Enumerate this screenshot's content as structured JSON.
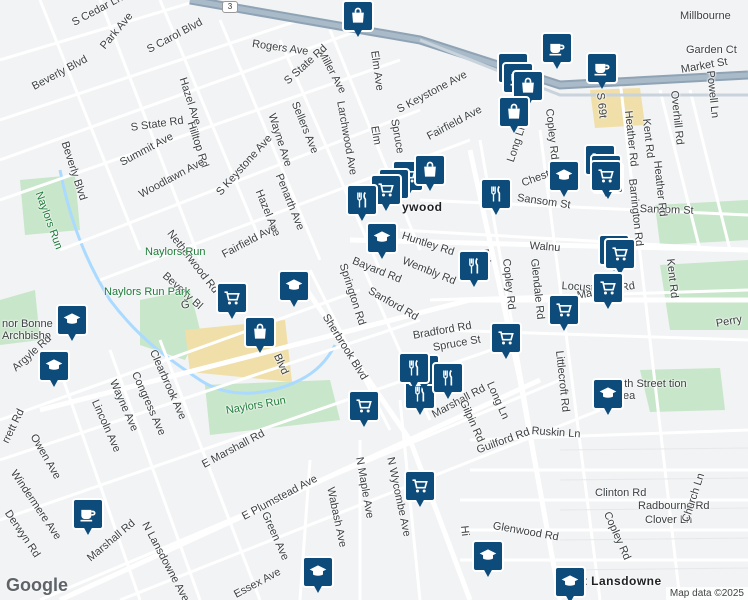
{
  "map": {
    "colors": {
      "land": "#f1f3f4",
      "road": "#ffffff",
      "highway": "#8fa3b5",
      "park": "#c8e6c9",
      "water": "#aadaff",
      "pin": "#0d4b7a",
      "zone": "#f0dfa8"
    },
    "place_labels": {
      "neighborhood": "ywood",
      "eastLansdowne": "East Lansdowne",
      "manorBonner": "nor Bonne Archbisho",
      "naylorsRunPark": "Naylors Run Park",
      "naylorsRun1": "Naylors Run",
      "naylorsRun2": "Naylors Run",
      "naylorsRun3": "Naylors Run",
      "sixtyNinth": "69th Street tion Area",
      "route3": "3"
    },
    "street_labels": {
      "sCedarLn": "S Cedar Ln",
      "parkAve": "Park Ave",
      "sCarolBlvd": "S Carol Blvd",
      "rogersAve": "Rogers Ave",
      "millerAve": "Miller Ave",
      "elmAve": "Elm Ave",
      "sStateRd1": "S State Rd",
      "sStateRd2": "S State Rd",
      "hazelAve1": "Hazel Ave",
      "hazelAve2": "Hazel Ave",
      "beverlyBlvd1": "Beverly Blvd",
      "beverlyBlvd2": "Beverly Blvd",
      "beverlyBlvd3": "Beverly Bl",
      "sellersAve": "Sellers Ave",
      "larchwoodAve": "Larchwood Ave",
      "sKeystoneAve1": "S Keystone Ave",
      "sKeystoneAve2": "S Keystone Ave",
      "waynaAve": "Wayne Ave",
      "hilltopRd": "Hilltop Rd",
      "summitAve": "Summit Ave",
      "woodlawnAve": "Woodlawn Ave",
      "penarthAve": "Penarth Ave",
      "fairfieldAve1": "Fairfield Ave",
      "fairfieldAve2": "Fairfield Ave",
      "spruce1": "Spruce",
      "elm2": "Elm",
      "netherwoodRd": "Netherwood Rd",
      "bayardRd": "Bayard Rd",
      "wemblyRd": "Wembly Rd",
      "sanfordRd": "Sanford Rd",
      "springtonRd": "Springton Rd",
      "huntleyRd": "Huntley Rd",
      "sherbrookBlvd": "Sherbrook Blvd",
      "bradfordRd": "Bradford Rd",
      "spruceSt": "Spruce St",
      "marshallRd1": "Marshall Rd",
      "marshallRd2": "Marshall Rd",
      "marshallRd3": "E Marshall Rd",
      "marshallRd4": "Marshall Rd",
      "longLn1": "Long Ln",
      "longLn2": "Long Ln",
      "gilpinRd": "Gilpin Rd",
      "copleyRd1": "Copley Rd",
      "copleyRd2": "Copley Rd",
      "copleyRd3": "Copley Rd",
      "glendaleRd": "Glendale Rd",
      "sansomSt1": "Sansom St",
      "sansomSt2": "Sansom St",
      "walnut": "Walnu",
      "locust": "Locust",
      "barringtonRd": "Barrington Rd",
      "heatherRd1": "Heather Rd",
      "heatherRd2": "Heather Rd",
      "kentRd1": "Kent Rd",
      "kentRd2": "Kent Rd",
      "overhillRd": "Overhill Rd",
      "powellLn": "Powell Ln",
      "gardenCt": "Garden Ct",
      "marketSt": "Market St",
      "millbourne": "Millbourne",
      "perry": "Perry",
      "littlecroftRd": "Littlecroft Rd",
      "ruskinLn": "Ruskin Ln",
      "guilfordRd": "Guilford Rd",
      "clintonRd": "Clinton Rd",
      "radbourneRd": "Radbourne Rd",
      "cloverLn": "Clover Ln",
      "glenwoodRd": "Glenwood Rd",
      "churchLn": "Church Ln",
      "argyleRd": "Argyle Rd",
      "owenAve": "Owen Ave",
      "rrettRd": "rrett Rd",
      "windermereAve": "Windermere Ave",
      "derwynRd": "Derwyn Rd",
      "lincolnAve": "Lincoln Ave",
      "waynaAve2": "Wayne Ave",
      "congressAve": "Congress Ave",
      "clearbrookAve": "Clearbrook Ave",
      "ePlumsteadAve": "E Plumstead Ave",
      "nLansdowneAve": "N Lansdowne Ave",
      "greenAve": "Green Ave",
      "essexAve": "Essex Ave",
      "wabashAve": "Wabash Ave",
      "nMapleAve": "N Maple Ave",
      "nWycombeAve": "N Wycombe Ave",
      "chest": "Chest",
      "blvd": "Blvd",
      "gl": "G",
      "hi": "Hi",
      "s69": "S 69t",
      "rd1": "Rd",
      "rd2": "Rd",
      "rd3": "Rd"
    },
    "pins": [
      {
        "icon": "shopping-bag-icon",
        "name": "pin-shopping-bag"
      },
      {
        "icon": "coffee-cup-icon",
        "name": "pin-coffee"
      },
      {
        "icon": "coffee-cup-icon",
        "name": "pin-coffee"
      },
      {
        "icon": "coffee-cup-icon",
        "name": "pin-coffee"
      },
      {
        "icon": "coffee-cup-icon",
        "name": "pin-coffee"
      },
      {
        "icon": "shopping-bag-icon",
        "name": "pin-shopping-bag"
      },
      {
        "icon": "shopping-bag-icon",
        "name": "pin-shopping-bag"
      },
      {
        "icon": "shopping-cart-icon",
        "name": "pin-grocery"
      },
      {
        "icon": "shopping-cart-icon",
        "name": "pin-grocery"
      },
      {
        "icon": "shopping-cart-icon",
        "name": "pin-grocery"
      },
      {
        "icon": "shopping-bag-icon",
        "name": "pin-shopping-bag"
      },
      {
        "icon": "fork-knife-icon",
        "name": "pin-restaurant"
      },
      {
        "icon": "fork-knife-icon",
        "name": "pin-restaurant"
      },
      {
        "icon": "graduation-cap-icon",
        "name": "pin-school"
      },
      {
        "icon": "graduation-cap-icon",
        "name": "pin-school"
      },
      {
        "icon": "shopping-cart-icon",
        "name": "pin-grocery"
      },
      {
        "icon": "shopping-cart-icon",
        "name": "pin-grocery"
      },
      {
        "icon": "shopping-cart-icon",
        "name": "pin-grocery"
      },
      {
        "icon": "shopping-bag-icon",
        "name": "pin-shopping-bag"
      },
      {
        "icon": "shopping-cart-icon",
        "name": "pin-grocery"
      },
      {
        "icon": "fork-knife-icon",
        "name": "pin-restaurant"
      },
      {
        "icon": "shopping-cart-icon",
        "name": "pin-grocery"
      },
      {
        "icon": "shopping-cart-icon",
        "name": "pin-grocery"
      },
      {
        "icon": "graduation-cap-icon",
        "name": "pin-school"
      },
      {
        "icon": "shopping-cart-icon",
        "name": "pin-grocery"
      },
      {
        "icon": "shopping-bag-icon",
        "name": "pin-shopping-bag"
      },
      {
        "icon": "graduation-cap-icon",
        "name": "pin-school"
      },
      {
        "icon": "graduation-cap-icon",
        "name": "pin-school"
      },
      {
        "icon": "shopping-cart-icon",
        "name": "pin-grocery"
      },
      {
        "icon": "shopping-cart-icon",
        "name": "pin-grocery"
      },
      {
        "icon": "shopping-cart-icon",
        "name": "pin-grocery"
      },
      {
        "icon": "fork-knife-icon",
        "name": "pin-restaurant"
      },
      {
        "icon": "fork-knife-icon",
        "name": "pin-restaurant"
      },
      {
        "icon": "fork-knife-icon",
        "name": "pin-restaurant"
      },
      {
        "icon": "fork-knife-icon",
        "name": "pin-restaurant"
      },
      {
        "icon": "graduation-cap-icon",
        "name": "pin-school"
      },
      {
        "icon": "shopping-cart-icon",
        "name": "pin-grocery"
      },
      {
        "icon": "coffee-cup-icon",
        "name": "pin-coffee"
      },
      {
        "icon": "graduation-cap-icon",
        "name": "pin-school"
      },
      {
        "icon": "graduation-cap-icon",
        "name": "pin-school"
      },
      {
        "icon": "graduation-cap-icon",
        "name": "pin-school"
      }
    ],
    "attribution": "Map data ©2025",
    "logo": "Google"
  }
}
